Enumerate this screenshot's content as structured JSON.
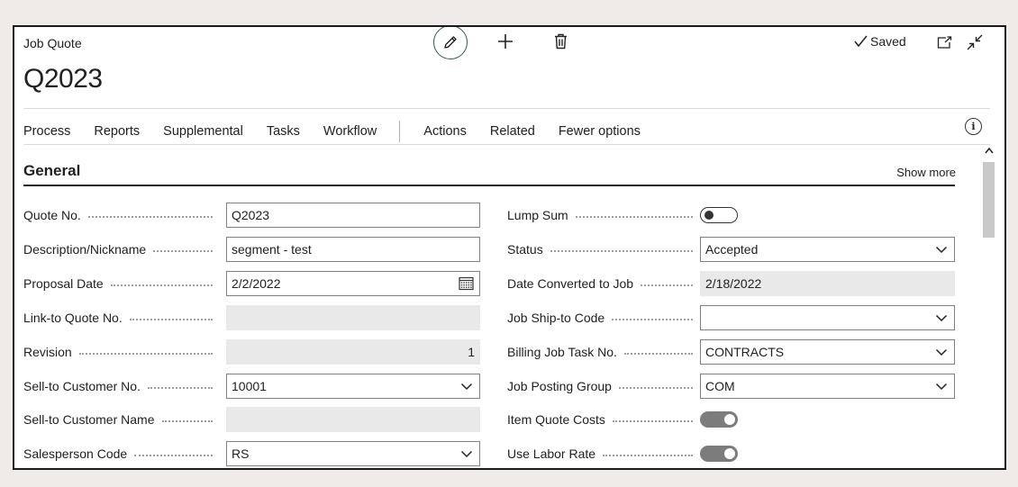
{
  "header": {
    "page_type": "Job Quote",
    "record_title": "Q2023",
    "saved_label": "Saved"
  },
  "menu": {
    "items": [
      "Process",
      "Reports",
      "Supplemental",
      "Tasks",
      "Workflow"
    ],
    "secondary": [
      "Actions",
      "Related",
      "Fewer options"
    ]
  },
  "section": {
    "title": "General",
    "show_more": "Show more"
  },
  "left_fields": [
    {
      "label": "Quote No.",
      "value": "Q2023",
      "kind": "text"
    },
    {
      "label": "Description/Nickname",
      "value": "segment - test",
      "kind": "text"
    },
    {
      "label": "Proposal Date",
      "value": "2/2/2022",
      "kind": "date"
    },
    {
      "label": "Link-to Quote No.",
      "value": "",
      "kind": "disabled"
    },
    {
      "label": "Revision",
      "value": "1",
      "kind": "disabled-number"
    },
    {
      "label": "Sell-to Customer No.",
      "value": "10001",
      "kind": "dropdown"
    },
    {
      "label": "Sell-to Customer Name",
      "value": "",
      "kind": "disabled"
    },
    {
      "label": "Salesperson Code",
      "value": "RS",
      "kind": "dropdown"
    }
  ],
  "right_fields": [
    {
      "label": "Lump Sum",
      "value": "off",
      "kind": "toggle"
    },
    {
      "label": "Status",
      "value": "Accepted",
      "kind": "select"
    },
    {
      "label": "Date Converted to Job",
      "value": "2/18/2022",
      "kind": "disabled"
    },
    {
      "label": "Job Ship-to Code",
      "value": "",
      "kind": "dropdown"
    },
    {
      "label": "Billing Job Task No.",
      "value": "CONTRACTS",
      "kind": "dropdown"
    },
    {
      "label": "Job Posting Group",
      "value": "COM",
      "kind": "dropdown"
    },
    {
      "label": "Item Quote Costs",
      "value": "on",
      "kind": "toggle"
    },
    {
      "label": "Use Labor Rate",
      "value": "on",
      "kind": "toggle"
    }
  ],
  "colors": {
    "accent": "#2f5b56",
    "toggle_on": "#7c7c7c",
    "disabled_field": "#e9e9e9"
  },
  "icons": {
    "edit": "pencil-icon",
    "add": "plus-icon",
    "delete": "trash-icon",
    "saved": "checkmark-icon",
    "open": "open-in-new-window-icon",
    "collapse": "collapse-icon",
    "info": "info-icon",
    "date": "calendar-icon",
    "dropdown": "chevron-down-icon"
  }
}
